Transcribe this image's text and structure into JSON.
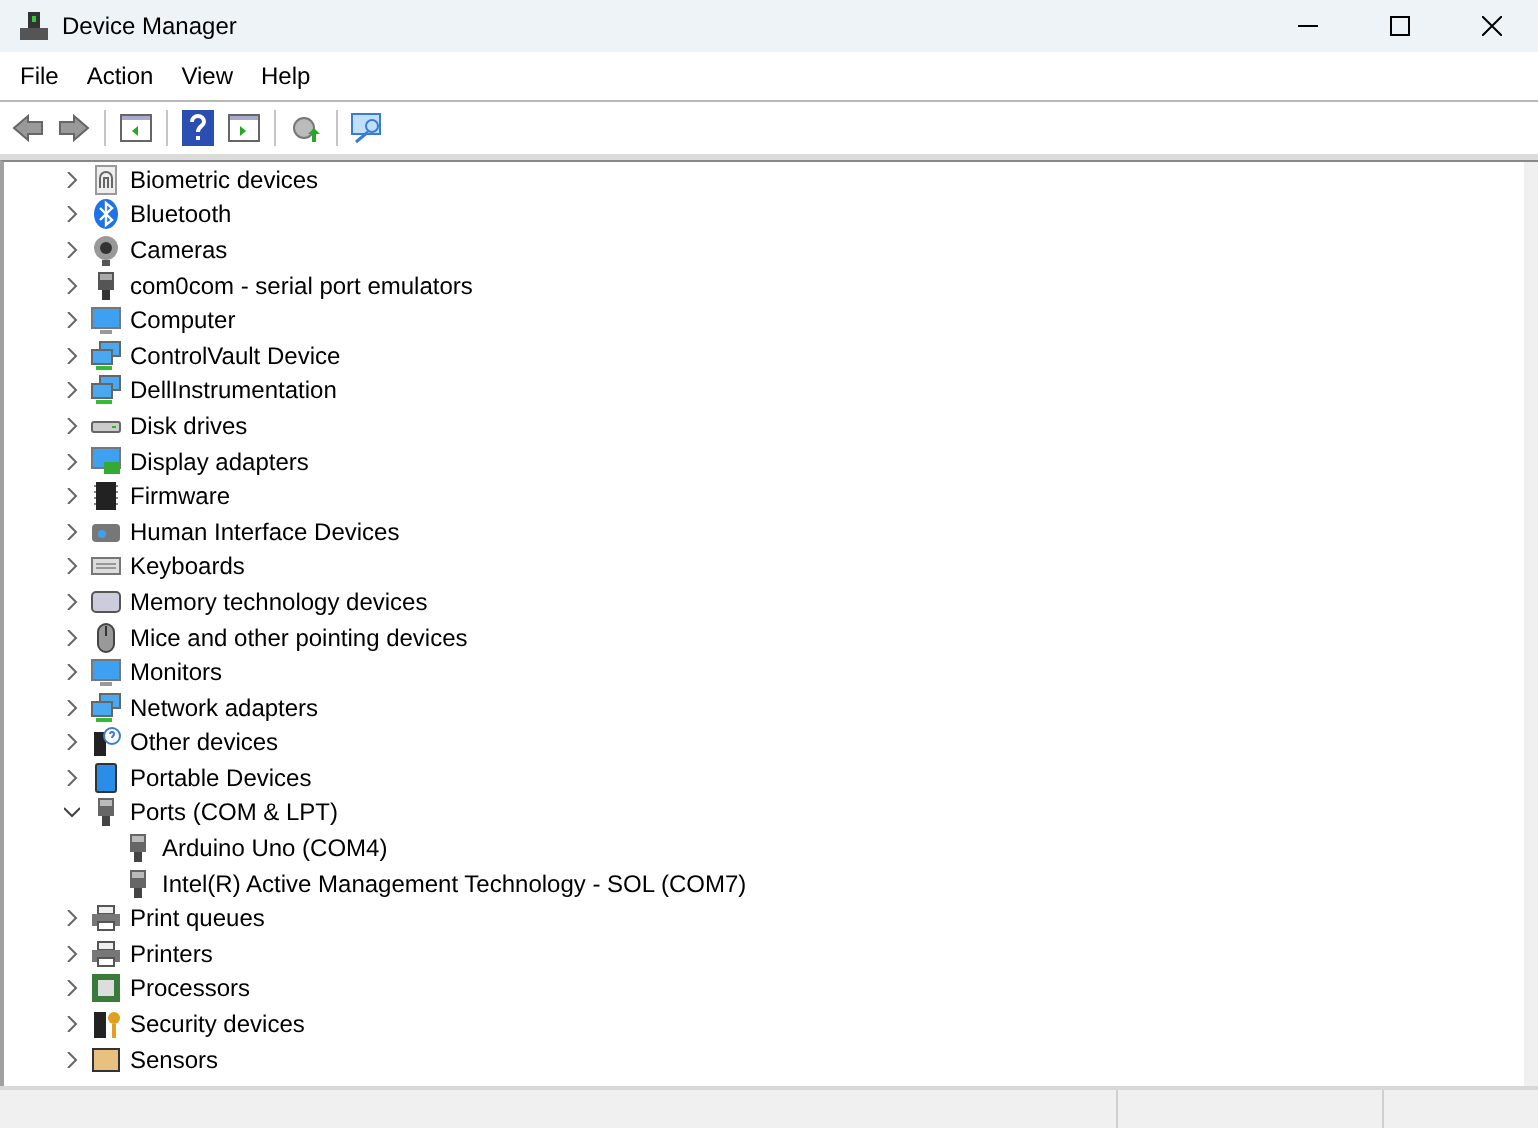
{
  "window": {
    "title": "Device Manager"
  },
  "menu": [
    "File",
    "Action",
    "View",
    "Help"
  ],
  "tree": [
    {
      "label": "Biometric devices",
      "expanded": false
    },
    {
      "label": "Bluetooth",
      "expanded": false
    },
    {
      "label": "Cameras",
      "expanded": false
    },
    {
      "label": "com0com - serial port emulators",
      "expanded": false
    },
    {
      "label": "Computer",
      "expanded": false
    },
    {
      "label": "ControlVault Device",
      "expanded": false
    },
    {
      "label": "DellInstrumentation",
      "expanded": false
    },
    {
      "label": "Disk drives",
      "expanded": false
    },
    {
      "label": "Display adapters",
      "expanded": false
    },
    {
      "label": "Firmware",
      "expanded": false
    },
    {
      "label": "Human Interface Devices",
      "expanded": false
    },
    {
      "label": "Keyboards",
      "expanded": false
    },
    {
      "label": "Memory technology devices",
      "expanded": false
    },
    {
      "label": "Mice and other pointing devices",
      "expanded": false
    },
    {
      "label": "Monitors",
      "expanded": false
    },
    {
      "label": "Network adapters",
      "expanded": false
    },
    {
      "label": "Other devices",
      "expanded": false
    },
    {
      "label": "Portable Devices",
      "expanded": false
    },
    {
      "label": "Ports (COM & LPT)",
      "expanded": true,
      "children": [
        {
          "label": "Arduino Uno (COM4)"
        },
        {
          "label": "Intel(R) Active Management Technology - SOL (COM7)"
        }
      ]
    },
    {
      "label": "Print queues",
      "expanded": false
    },
    {
      "label": "Printers",
      "expanded": false
    },
    {
      "label": "Processors",
      "expanded": false
    },
    {
      "label": "Security devices",
      "expanded": false
    },
    {
      "label": "Sensors",
      "expanded": false
    }
  ]
}
